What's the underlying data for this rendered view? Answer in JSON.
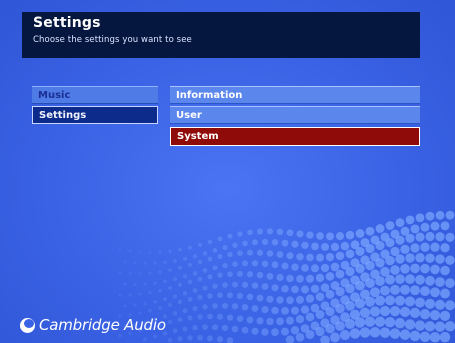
{
  "header": {
    "title": "Settings",
    "subtitle": "Choose the settings you want to see"
  },
  "left_menu": {
    "items": [
      {
        "label": "Music",
        "state": "normal"
      },
      {
        "label": "Settings",
        "state": "selected"
      }
    ]
  },
  "right_menu": {
    "items": [
      {
        "label": "Information",
        "state": "normal"
      },
      {
        "label": "User",
        "state": "normal"
      },
      {
        "label": "System",
        "state": "highlighted"
      }
    ]
  },
  "brand": {
    "name": "Cambridge Audio"
  },
  "colors": {
    "background": "#3b63e6",
    "header_bg": "#05173f",
    "menu_item": "#5b86ec",
    "selected_left": "#0d2b8a",
    "highlight": "#8f0b09",
    "text": "#ffffff"
  }
}
